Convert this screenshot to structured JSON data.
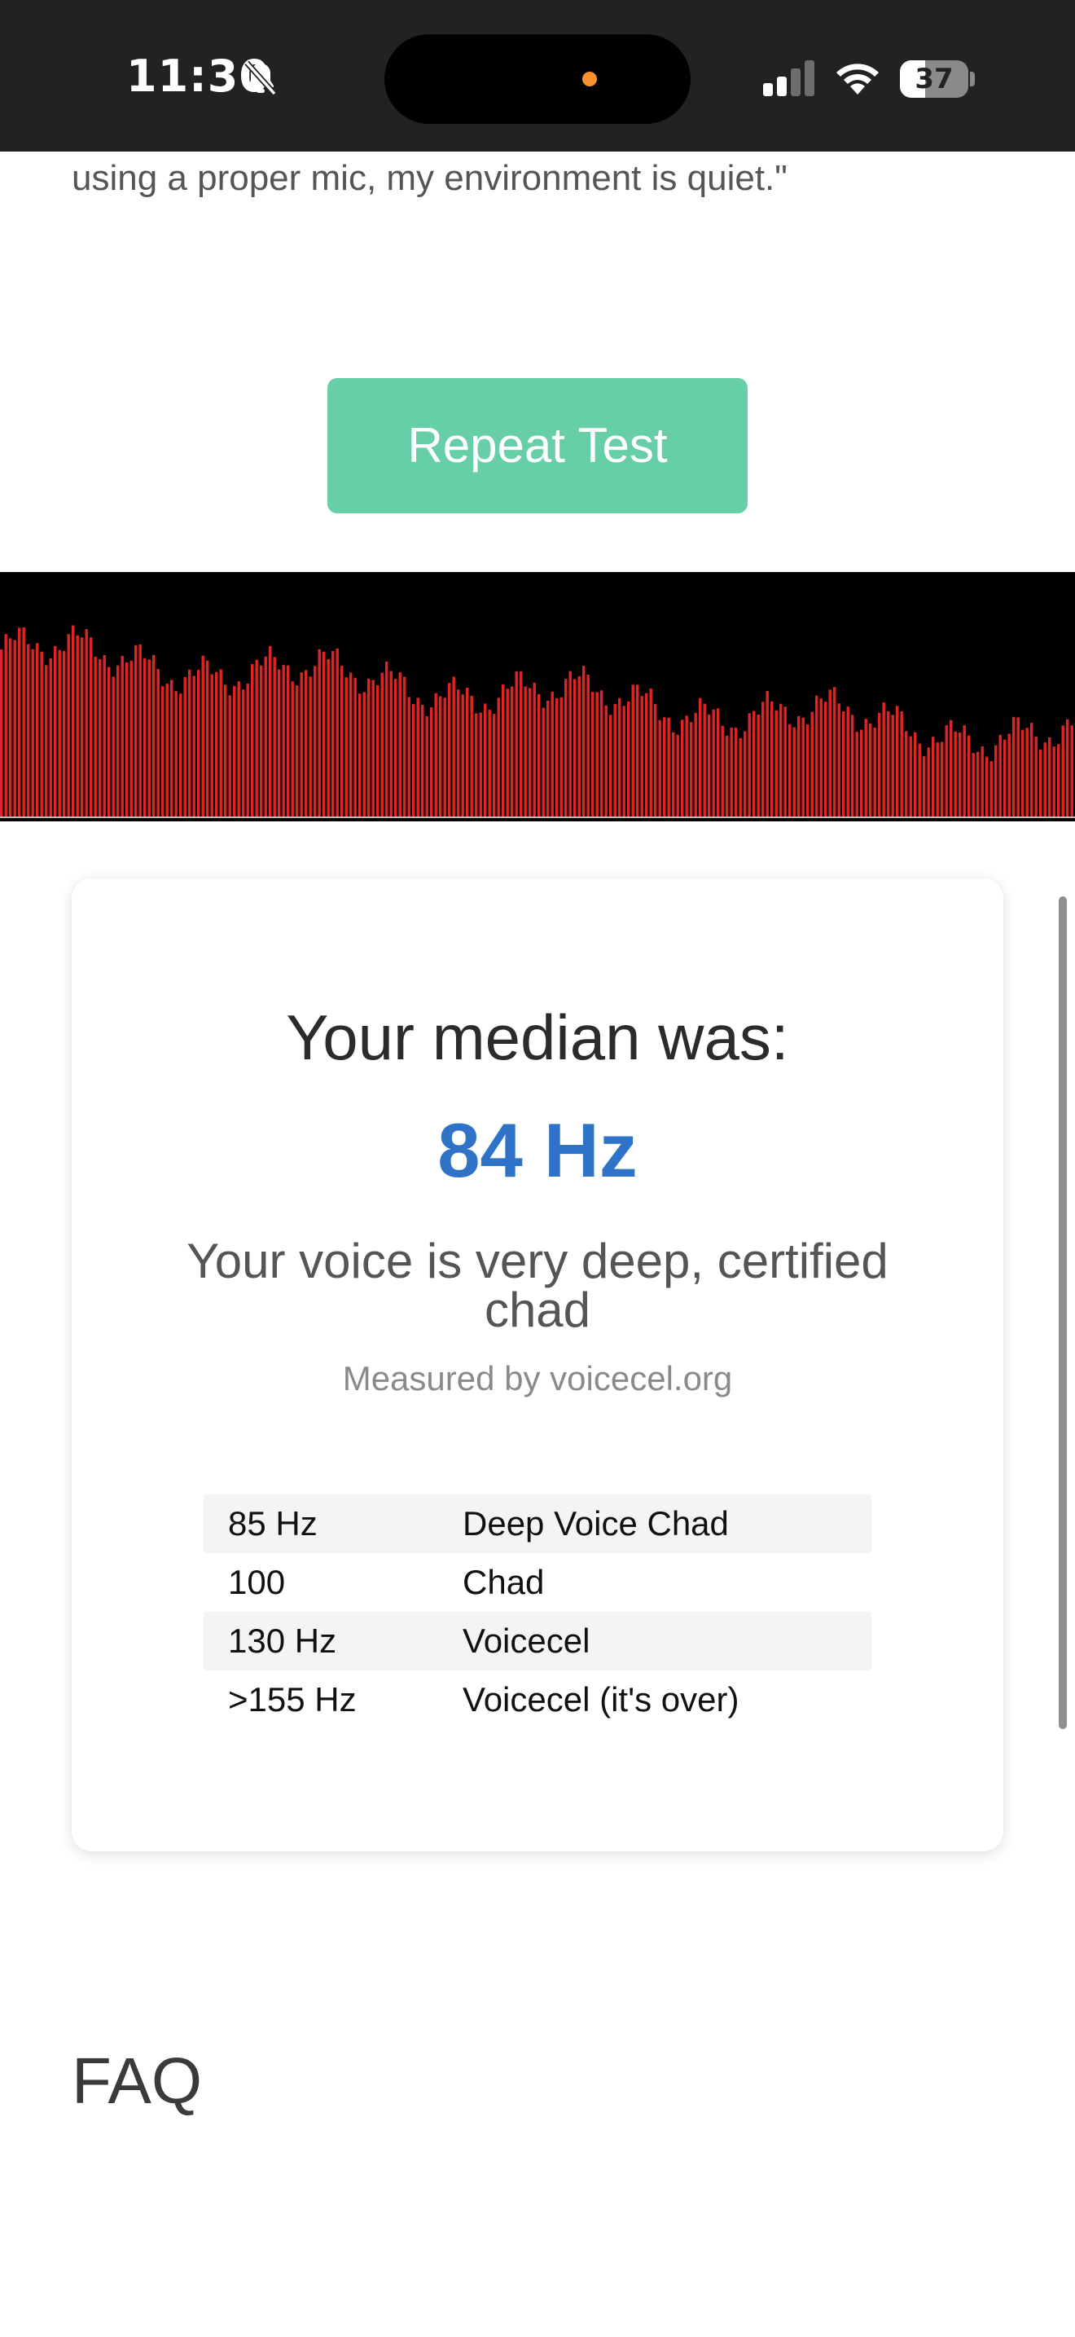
{
  "status_bar": {
    "time": "11:30",
    "battery": "37",
    "battery_level": 0.37,
    "icons": [
      "bell-slash-icon",
      "signal-icon",
      "wifi-icon",
      "battery-icon"
    ],
    "mic_indicator_color": "#f7922f"
  },
  "page": {
    "quote_tail": "using a proper mic, my environment is quiet.\"",
    "repeat_button_label": "Repeat Test",
    "faq_heading": "FAQ"
  },
  "colors": {
    "accent_button": "#66cfa8",
    "median_value": "#2e73c8",
    "visualizer_bar": "#e02424"
  },
  "result": {
    "median_label": "Your median was:",
    "median_value": "84 Hz",
    "verdict": "Your voice is very deep, certified chad",
    "measured_by": "Measured by voicecel.org",
    "ranges": [
      {
        "hz": "85 Hz",
        "label": "Deep Voice Chad"
      },
      {
        "hz": "100",
        "label": "Chad"
      },
      {
        "hz": "130 Hz",
        "label": "Voicecel"
      },
      {
        "hz": ">155 Hz",
        "label": "Voicecel (it's over)"
      }
    ]
  }
}
